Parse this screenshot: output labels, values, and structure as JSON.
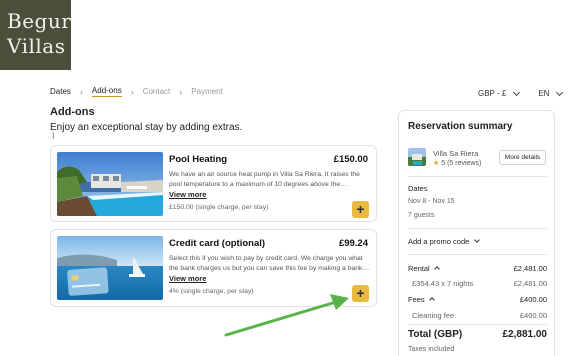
{
  "logo": {
    "line1": "Begur",
    "line2": "Villas"
  },
  "breadcrumb": [
    {
      "label": "Dates",
      "state": "done"
    },
    {
      "label": "Add-ons",
      "state": "active"
    },
    {
      "label": "Contact",
      "state": "upcoming"
    },
    {
      "label": "Payment",
      "state": "upcoming"
    }
  ],
  "selectors": {
    "currency": "GBP - £",
    "language": "EN"
  },
  "addons": {
    "title": "Add-ons",
    "subtitle": "Enjoy an exceptional stay by adding extras.",
    "items": [
      {
        "title": "Pool Heating",
        "price": "£150.00",
        "description": "We have an air source heat pump in Villa Sa Riera. It raises the pool temperature to a maximum of 10 degrees above the…",
        "more_label": "View more",
        "charge": "£150.00 (single charge, per stay)",
        "add_label": "+"
      },
      {
        "title": "Credit card (optional)",
        "price": "£99.24",
        "description": "Select this if you wish to pay by credit card. We charge you what the bank charges us but you can save this fee by making a bank…",
        "more_label": "View more",
        "charge": "4% (single charge, per stay)",
        "add_label": "+"
      }
    ]
  },
  "summary": {
    "title": "Reservation summary",
    "villa_name": "Villa Sa Riera",
    "rating": "5 (5 reviews)",
    "more_details": "More details",
    "dates_label": "Dates",
    "dates_value": "Nov 8 - Nov 15",
    "guests": "7 guests",
    "promo_label": "Add a promo code",
    "rental_label": "Rental",
    "rental_value": "£2,481.00",
    "rental_detail_label": "£354.43 x 7 nights",
    "rental_detail_value": "£2,481.00",
    "fees_label": "Fees",
    "fees_value": "£400.00",
    "cleaning_label": "Cleaning fee",
    "cleaning_value": "£400.00",
    "total_label": "Total (GBP)",
    "total_value": "£2,881.00",
    "taxes_note": "Taxes included"
  },
  "colors": {
    "accent": "#e9b940",
    "arrow": "#5ab34a",
    "logo_bg": "#4a4e3a"
  }
}
